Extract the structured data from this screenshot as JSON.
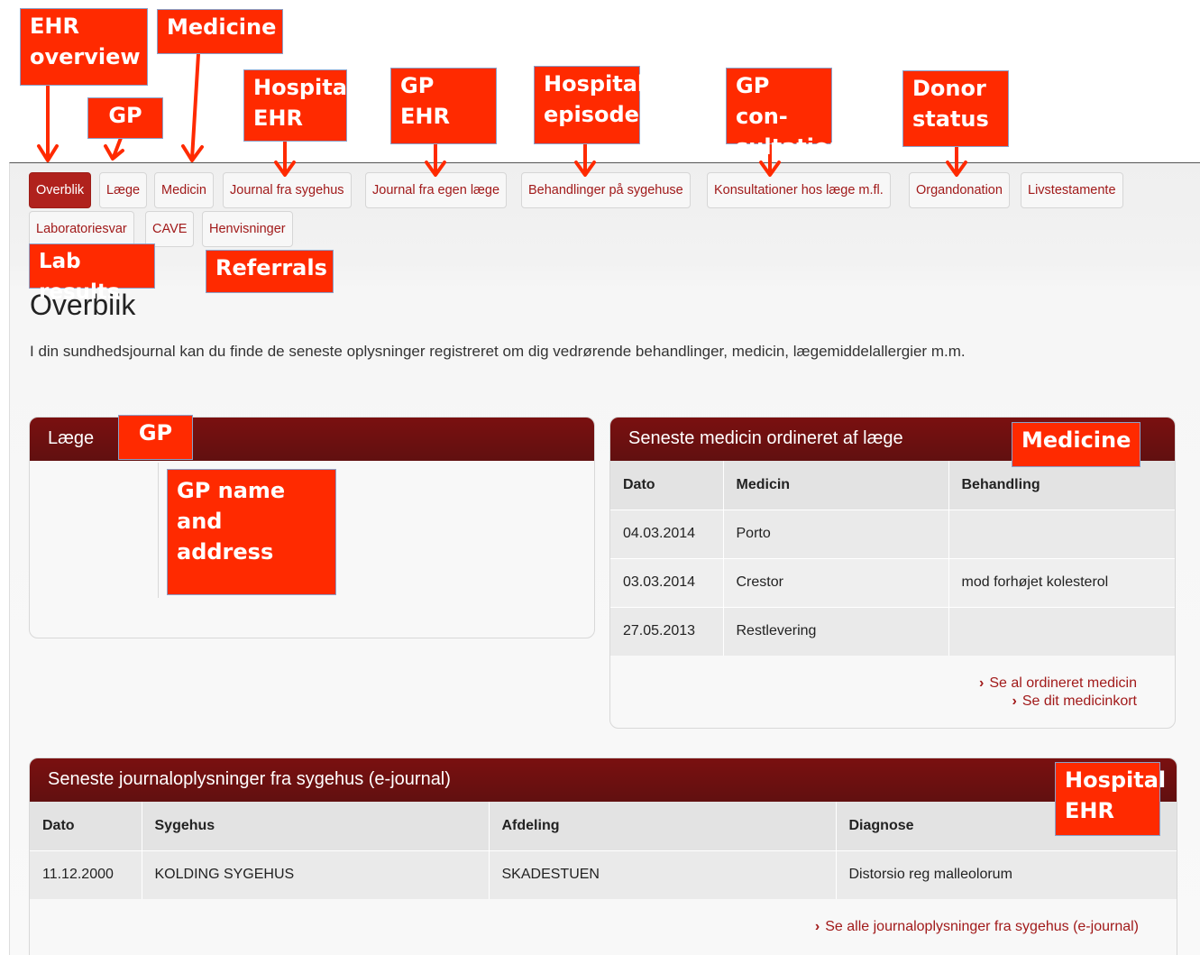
{
  "tabs": {
    "overblik": "Overblik",
    "laege": "Læge",
    "medicin": "Medicin",
    "journal_sygehus": "Journal fra sygehus",
    "journal_laege": "Journal fra egen læge",
    "behandlinger": "Behandlinger på sygehuse",
    "konsultationer": "Konsultationer hos læge m.fl.",
    "organdonation": "Organdonation",
    "livstestamente": "Livstestamente",
    "laboratoriesvar": "Laboratoriesvar",
    "cave": "CAVE",
    "henvisninger": "Henvisninger"
  },
  "annotations": {
    "ehr_overview": "EHR\noverview",
    "medicine_top": "Medicine",
    "hospital_ehr_top": "Hospital\nEHR",
    "gp_top": "GP",
    "gp_ehr": "GP\nEHR",
    "hospital_episodes": "Hospital\nepisodes",
    "gp_consultation": "GP con-\nsultation",
    "donor_status": "Donor\nstatus",
    "lab_results": "Lab results",
    "referrals": "Referrals",
    "gp_panel": "GP",
    "gp_name_address": "GP name\nand address",
    "medicine_panel": "Medicine",
    "hospital_ehr_panel": "Hospital\nEHR"
  },
  "colors": {
    "accent": "#b0221d",
    "panel_header": "#6a1010",
    "callout": "#ff2a00",
    "link": "#a11a1a"
  },
  "page": {
    "title": "Overblik",
    "intro": "I din sundhedsjournal kan du finde de seneste oplysninger registreret om dig vedrørende behandlinger, medicin, lægemiddelallergier m.m."
  },
  "gp_panel": {
    "title": "Læge"
  },
  "medicine_panel": {
    "title": "Seneste medicin ordineret af læge",
    "headers": [
      "Dato",
      "Medicin",
      "Behandling"
    ],
    "rows": [
      [
        "04.03.2014",
        "Porto",
        ""
      ],
      [
        "03.03.2014",
        "Crestor",
        "mod forhøjet kolesterol"
      ],
      [
        "27.05.2013",
        "Restlevering",
        ""
      ]
    ],
    "link_all": "Se al ordineret medicin",
    "link_card": "Se dit medicinkort",
    "link_chevron": "›"
  },
  "hospital_panel": {
    "title": "Seneste journaloplysninger fra sygehus (e-journal)",
    "headers": [
      "Dato",
      "Sygehus",
      "Afdeling",
      "Diagnose"
    ],
    "rows": [
      [
        "11.12.2000",
        "KOLDING SYGEHUS",
        "SKADESTUEN",
        "Distorsio reg malleolorum"
      ]
    ],
    "link_all": "Se alle journaloplysninger fra sygehus (e-journal)",
    "link_chevron": "›"
  }
}
